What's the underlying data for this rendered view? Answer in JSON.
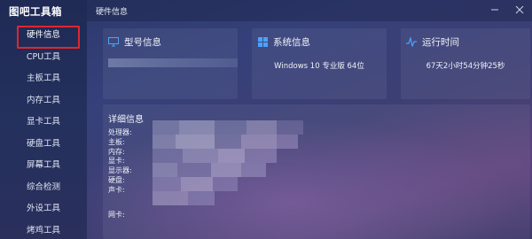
{
  "app": {
    "title": "图吧工具箱"
  },
  "window": {
    "page_title": "硬件信息",
    "controls": [
      "minimize-icon",
      "close-icon"
    ]
  },
  "sidebar": {
    "items": [
      {
        "label": "硬件信息",
        "active": true
      },
      {
        "label": "CPU工具"
      },
      {
        "label": "主板工具"
      },
      {
        "label": "内存工具"
      },
      {
        "label": "显卡工具"
      },
      {
        "label": "硬盘工具"
      },
      {
        "label": "屏幕工具"
      },
      {
        "label": "综合检测"
      },
      {
        "label": "外设工具"
      },
      {
        "label": "烤鸡工具"
      }
    ]
  },
  "cards": {
    "model": {
      "title": "型号信息",
      "icon": "monitor-icon",
      "value": ""
    },
    "system": {
      "title": "系统信息",
      "icon": "windows-logo-icon",
      "value": "Windows 10 专业版 64位"
    },
    "uptime": {
      "title": "运行时间",
      "icon": "pulse-icon",
      "value": "67天2小时54分钟25秒"
    }
  },
  "detail": {
    "title": "详细信息",
    "labels": [
      "处理器:",
      "主板:",
      "内存:",
      "显卡:",
      "显示器:",
      "硬盘:",
      "声卡:",
      "网卡:"
    ]
  },
  "colors": {
    "sidebar_bg": "#1f2a55",
    "accent_highlight": "#e0262d",
    "icon_blue": "#4aa3ff"
  }
}
